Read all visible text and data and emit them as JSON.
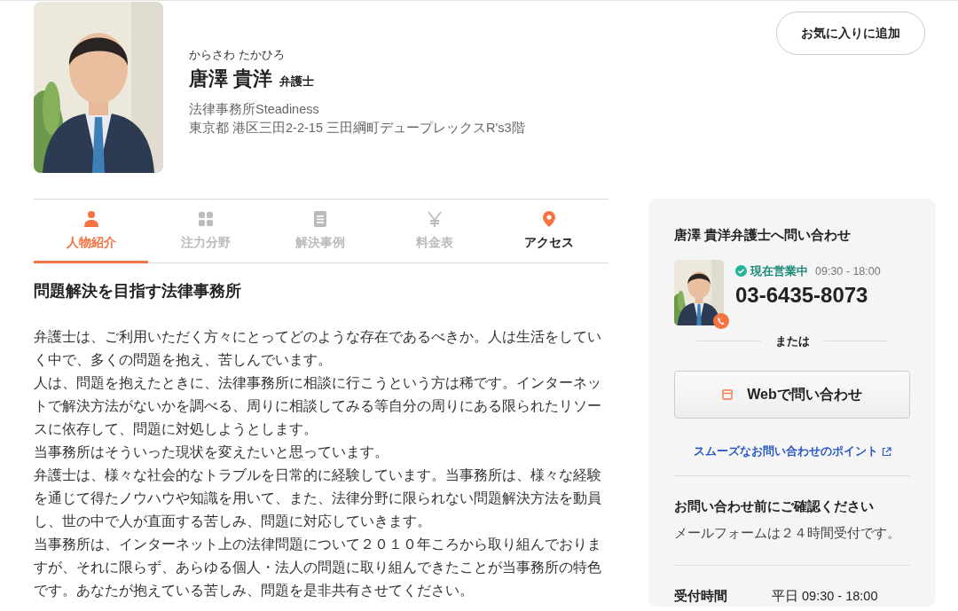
{
  "profile": {
    "reading": "からさわ たかひろ",
    "name": "唐澤 貴洋",
    "title": "弁護士",
    "office": "法律事務所Steadiness",
    "address": "東京都 港区三田2-2-15 三田綱町デュープレックスR's3階",
    "favorite_button": "お気に入りに追加"
  },
  "tabs": [
    {
      "label": "人物紹介",
      "selected": true,
      "disabled": false
    },
    {
      "label": "注力分野",
      "selected": false,
      "disabled": true
    },
    {
      "label": "解決事例",
      "selected": false,
      "disabled": true
    },
    {
      "label": "料金表",
      "selected": false,
      "disabled": true
    },
    {
      "label": "アクセス",
      "selected": false,
      "disabled": false
    }
  ],
  "section": {
    "heading": "問題解決を目指す法律事務所",
    "paragraphs": [
      "弁護士は、ご利用いただく方々にとってどのような存在であるべきか。人は生活をしていく中で、多くの問題を抱え、苦しんでいます。",
      "人は、問題を抱えたときに、法律事務所に相談に行こうという方は稀です。インターネットで解決方法がないかを調べる、周りに相談してみる等自分の周りにある限られたリソースに依存して、問題に対処しようとします。",
      "当事務所はそういった現状を変えたいと思っています。",
      "弁護士は、様々な社会的なトラブルを日常的に経験しています。当事務所は、様々な経験を通じて得たノウハウや知識を用いて、また、法律分野に限られない問題解決方法を動員し、世の中で人が直面する苦しみ、問題に対応していきます。",
      "当事務所は、インターネット上の法律問題について２０１０年ころから取り組んでおりますが、それに限らず、あらゆる個人・法人の問題に取り組んできたことが当事務所の特色です。あなたが抱えている苦しみ、問題を是非共有させてください。"
    ]
  },
  "contact": {
    "heading": "唐澤 貴洋弁護士へ問い合わせ",
    "open": true,
    "status": "現在営業中",
    "hours": "09:30 - 18:00",
    "phone": "03-6435-8073",
    "or": "または",
    "web_button": "Webで問い合わせ",
    "tips_link": "スムーズなお問い合わせのポイント",
    "notice_heading": "お問い合わせ前にご確認ください",
    "notice": "メールフォームは２４時間受付です。",
    "reception_label": "受付時間",
    "reception_value": "平日 09:30 - 18:00"
  }
}
